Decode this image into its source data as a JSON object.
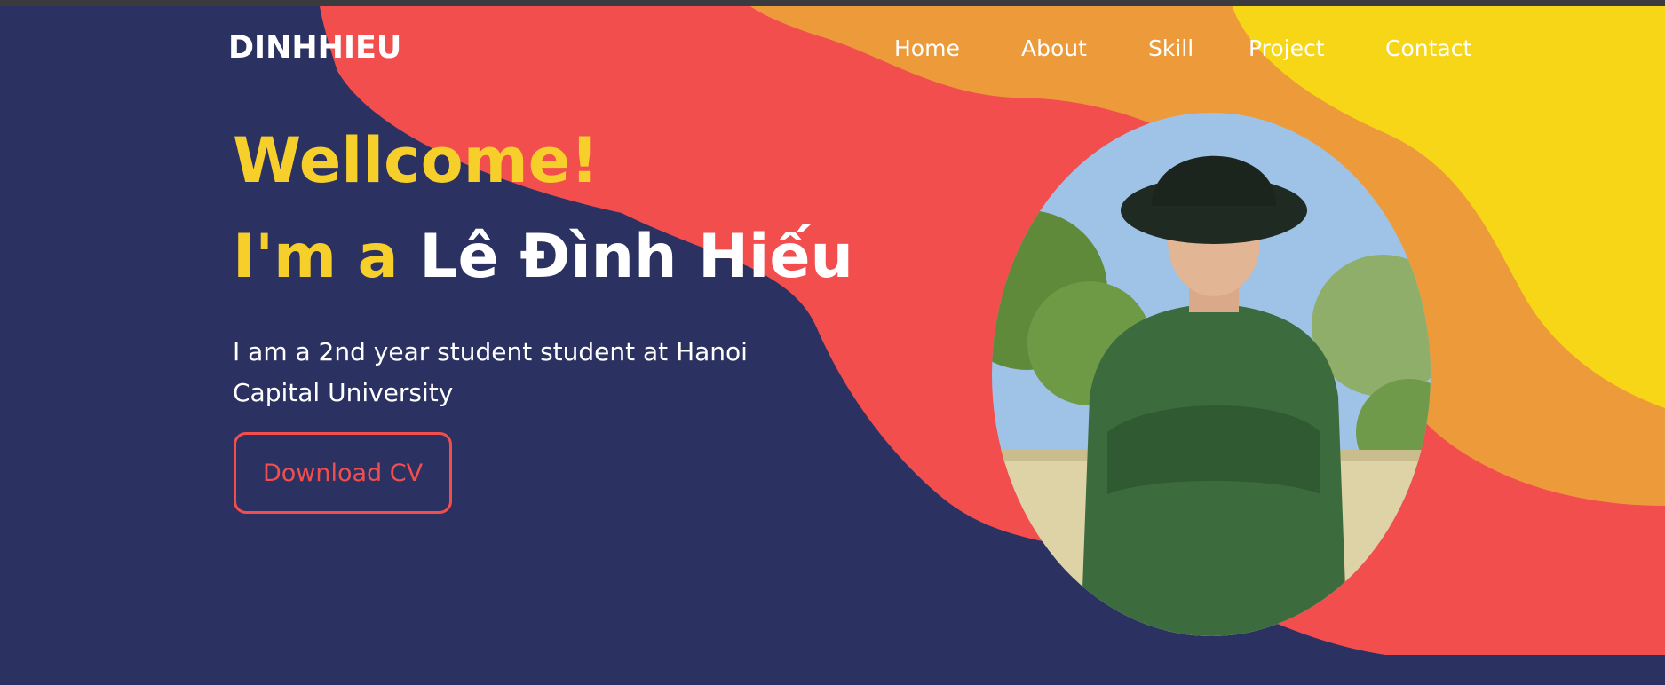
{
  "brand": {
    "logo_text": "DINHHIEU"
  },
  "nav": {
    "items": [
      {
        "label": "Home"
      },
      {
        "label": "About"
      },
      {
        "label": "Skill"
      },
      {
        "label": "Project"
      },
      {
        "label": "Contact"
      }
    ]
  },
  "hero": {
    "greeting": "Wellcome!",
    "intro_prefix": "I'm a ",
    "name": "Lê Đình Hiếu",
    "description": "I am a 2nd year student student at Hanoi Capital University",
    "cv_button_label": "Download CV"
  },
  "colors": {
    "background": "#2b3262",
    "accent_yellow": "#f7cf2a",
    "accent_red": "#f24e4e",
    "accent_orange": "#ec9a3a",
    "text_white": "#ffffff"
  },
  "portrait": {
    "alt": "Portrait photo of Lê Đình Hiếu",
    "icon": "profile-photo"
  }
}
